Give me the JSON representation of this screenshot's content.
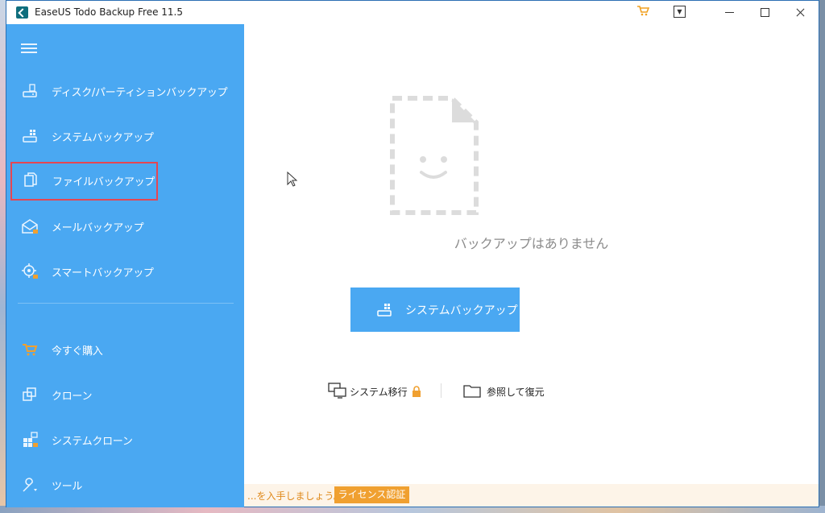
{
  "window": {
    "title": "EaseUS Todo Backup Free 11.5"
  },
  "titlebar_icons": [
    "cart-icon",
    "menu-dropdown-icon",
    "minimize-icon",
    "maximize-icon",
    "close-icon"
  ],
  "sidebar": {
    "items": [
      {
        "label": "ディスク/パーティションバックアップ",
        "icon": "disk-backup-icon",
        "selected": false
      },
      {
        "label": "システムバックアップ",
        "icon": "system-backup-icon",
        "selected": false
      },
      {
        "label": "ファイルバックアップ",
        "icon": "file-backup-icon",
        "selected": true
      },
      {
        "label": "メールバックアップ",
        "icon": "mail-backup-icon",
        "selected": false
      },
      {
        "label": "スマートバックアップ",
        "icon": "smart-backup-icon",
        "selected": false
      }
    ],
    "bottom_items": [
      {
        "label": "今すぐ購入",
        "icon": "cart-icon"
      },
      {
        "label": "クローン",
        "icon": "clone-icon"
      },
      {
        "label": "システムクローン",
        "icon": "system-clone-icon"
      },
      {
        "label": "ツール",
        "icon": "wrench-icon"
      }
    ]
  },
  "main": {
    "empty_message": "バックアップはありません",
    "primary_button": "システムバックアップ",
    "links": {
      "migrate": "システム移行",
      "restore": "参照して復元"
    }
  },
  "footer": {
    "promo_text": "...を入手しましょう。",
    "license_button": "ライセンス認証"
  },
  "colors": {
    "sidebar": "#4aa8f2",
    "accent": "#f0a030",
    "selection_outline": "#e54653"
  }
}
